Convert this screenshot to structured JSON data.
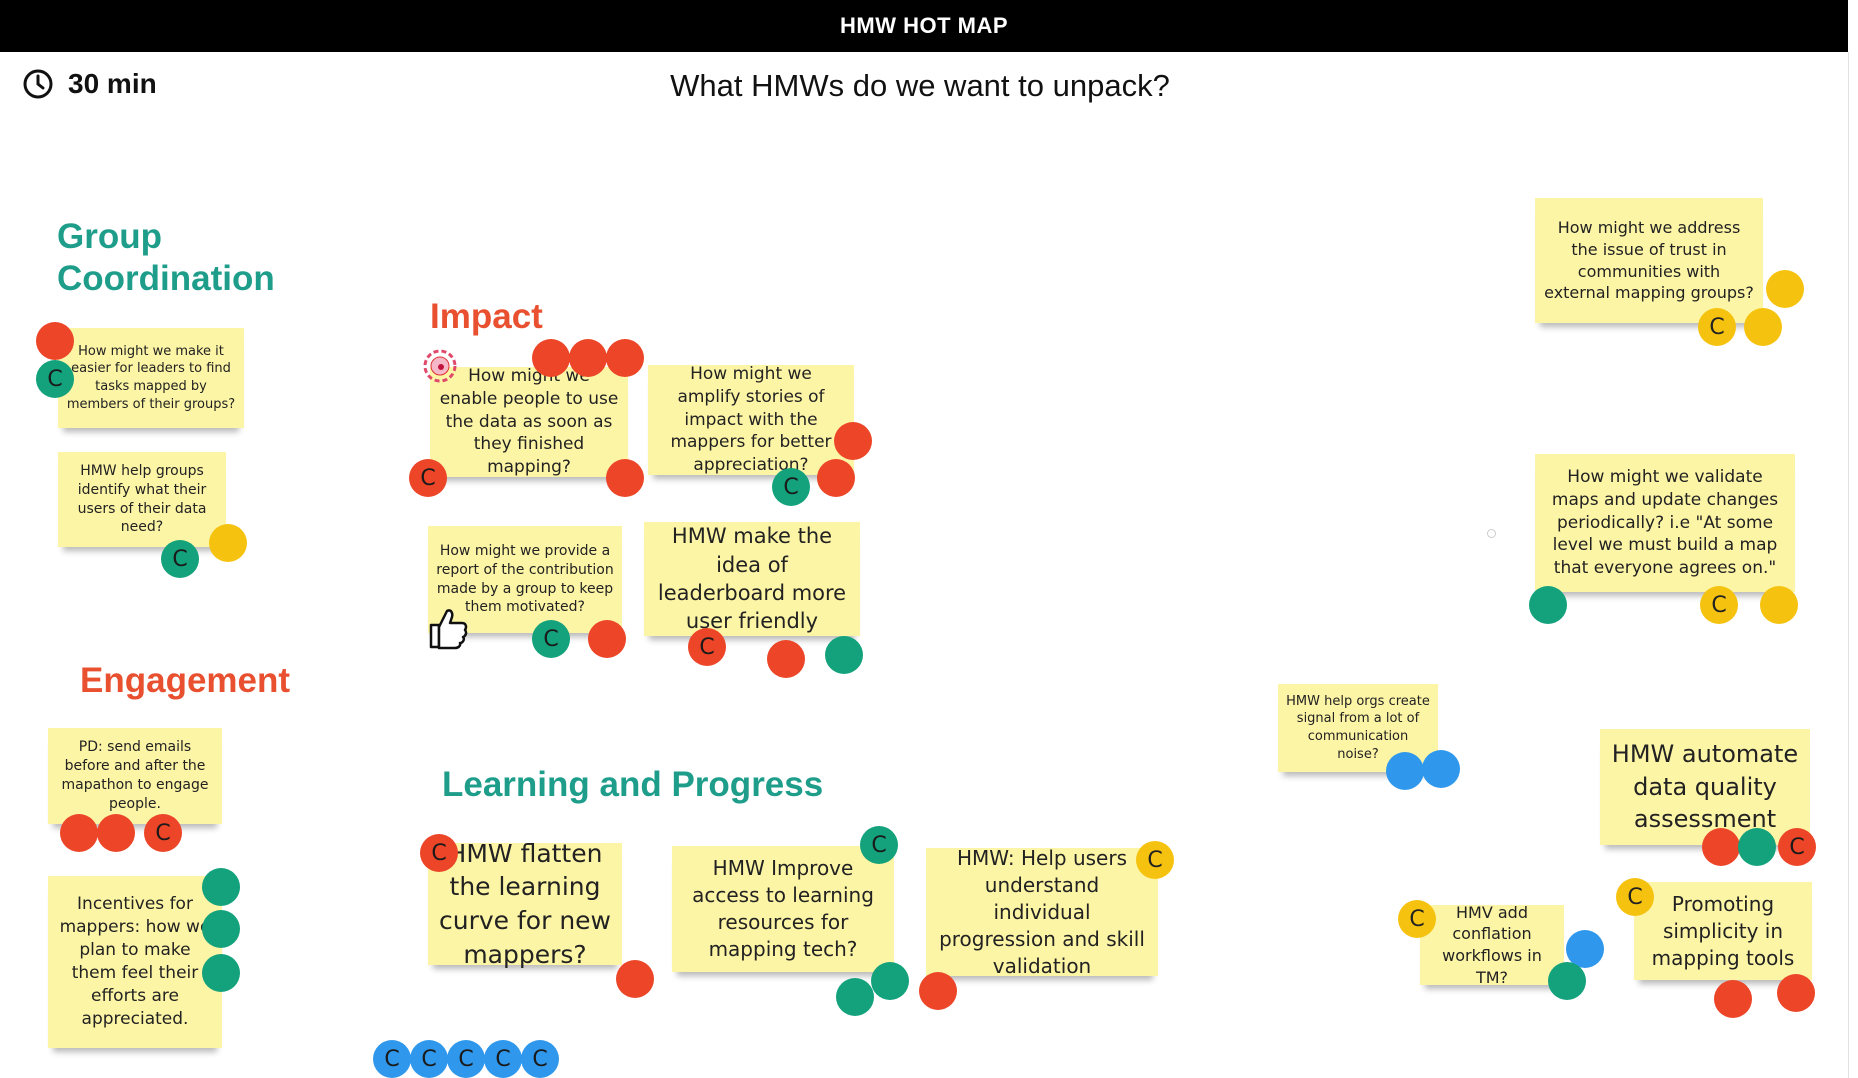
{
  "header": {
    "title": "HMW HOT MAP"
  },
  "timer": {
    "label": "30 min"
  },
  "question": "What HMWs do we want to unpack?",
  "headings": {
    "group_coordination": "Group\nCoordination",
    "impact": "Impact",
    "engagement": "Engagement",
    "learning": "Learning and Progress"
  },
  "notes": {
    "gc1": "How might we make it easier for leaders to find tasks mapped by members of their groups?",
    "gc2": "HMW help groups identify what their users  of their data need?",
    "im1": "How might we enable people to use the data as soon as they finished mapping?",
    "im2": "How might we amplify stories of impact with the mappers for better appreciation?",
    "im3": "How might we provide a report of the contribution made by a group to keep them motivated?",
    "im4": "HMW make the idea of leaderboard more user friendly",
    "en1": "PD: send emails before and after the mapathon to engage people.",
    "en2": "Incentives for mappers: how we plan to make them feel their efforts are appreciated.",
    "lp1": "HMW flatten the learning curve for new mappers?",
    "lp2": "HMW Improve access to learning resources for mapping tech?",
    "lp3": "HMW: Help users understand individual progression and skill validation",
    "r1": "How might we address the issue of trust in communities with external mapping groups?",
    "r2": "How might we validate maps and update changes periodically? i.e \"At some level we must build a map that everyone agrees on.\"",
    "r3": "HMW help orgs create signal from a lot of communication noise?",
    "r4": "HMW automate data quality assessment",
    "r5": "HMV add conflation workflows in TM?",
    "r6": "Promoting simplicity in mapping tools"
  },
  "dot_label": "C",
  "colors": {
    "red": "#ec4527",
    "teal": "#13a27c",
    "yellow": "#f5c30f",
    "blue": "#2f98ec",
    "note": "#fdf5a6",
    "heading_green": "#1e9e8a",
    "heading_red": "#e8502f"
  },
  "icons": [
    "clock-icon",
    "stamp-icon",
    "thumbs-up-icon"
  ]
}
